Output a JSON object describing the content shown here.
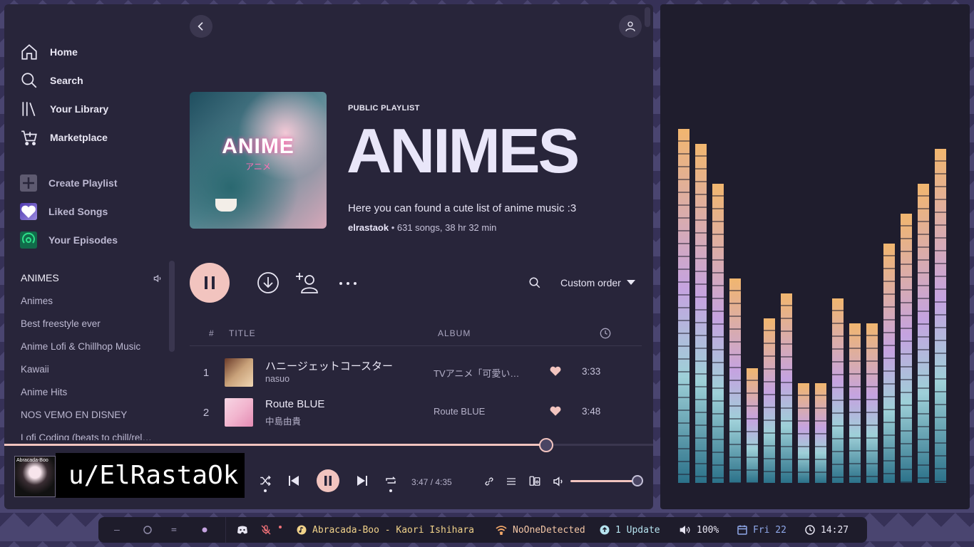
{
  "sidebar": {
    "nav": [
      {
        "label": "Home",
        "icon": "home-icon"
      },
      {
        "label": "Search",
        "icon": "search-icon"
      },
      {
        "label": "Your Library",
        "icon": "library-icon"
      },
      {
        "label": "Marketplace",
        "icon": "cart-icon"
      }
    ],
    "actions": [
      {
        "label": "Create Playlist",
        "icon": "plus-icon"
      },
      {
        "label": "Liked Songs",
        "icon": "heart-icon"
      },
      {
        "label": "Your Episodes",
        "icon": "podcast-icon"
      }
    ],
    "playlists": [
      "ANIMES",
      "Animes",
      "Best freestyle ever",
      "Anime Lofi & Chillhop Music",
      "Kawaii",
      "Anime Hits",
      "NOS VEMO EN DISNEY",
      "Lofi Coding (beats to chill/rel…"
    ]
  },
  "playlist": {
    "type_label": "PUBLIC PLAYLIST",
    "title": "ANIMES",
    "description": "Here you can found a cute list of anime music :3",
    "owner": "elrastaok",
    "meta": " • 631 songs, 38 hr 32 min",
    "cover_title": "ANIME",
    "cover_subtitle": "アニメ",
    "sort_label": "Custom order"
  },
  "table": {
    "headers": {
      "num": "#",
      "title": "TITLE",
      "album": "ALBUM"
    },
    "rows": [
      {
        "num": "1",
        "title": "ハニージェットコースター",
        "artist": "nasuo",
        "album": "TVアニメ「可愛い…",
        "duration": "3:33",
        "liked": true,
        "thumb_color": "#c9a27a"
      },
      {
        "num": "2",
        "title": "Route BLUE",
        "artist": "中島由貴",
        "album": "Route BLUE",
        "duration": "3:48",
        "liked": true,
        "thumb_color": "#f2b6cf"
      }
    ]
  },
  "player": {
    "progress": 0.835,
    "time": "3:47 / 4:35",
    "volume": 1.0,
    "art_label": "Abracada-Boo",
    "overlay_text": "u/ElRastaOk"
  },
  "visualizer": {
    "levels": [
      0.71,
      0.68,
      0.6,
      0.41,
      0.23,
      0.33,
      0.38,
      0.2,
      0.2,
      0.37,
      0.32,
      0.32,
      0.48,
      0.54,
      0.6,
      0.67
    ]
  },
  "taskbar": {
    "now_playing": "Abracada-Boo - Kaori Ishihara",
    "network": "NoOneDetected",
    "updates": "1 Update",
    "volume": "100%",
    "date": "Fri 22",
    "time": "14:27"
  },
  "colors": {
    "accent": "#f2c4bf",
    "background": "#28253a",
    "sidebar_text": "#e8e6f3",
    "visualizer_top": "#f1b66f",
    "visualizer_mid": "#c5a3e0",
    "visualizer_bottom": "#2b7189"
  }
}
